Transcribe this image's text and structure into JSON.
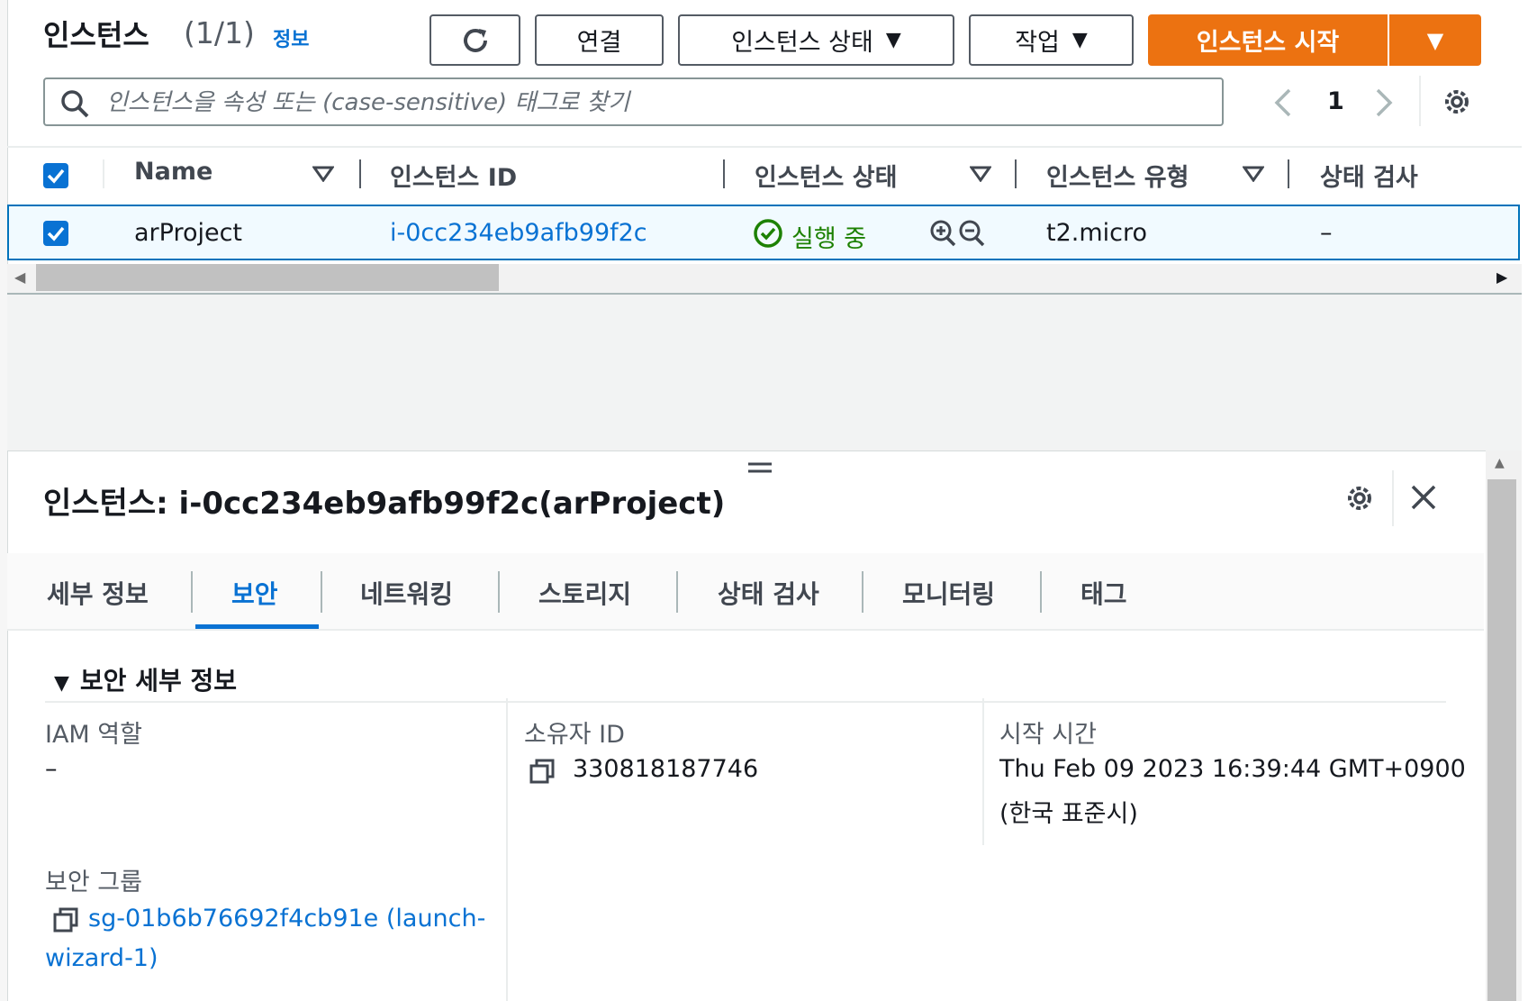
{
  "header": {
    "title": "인스턴스",
    "count": "(1/1)",
    "info_link": "정보",
    "connect_label": "연결",
    "instance_state_label": "인스턴스 상태",
    "actions_label": "작업",
    "launch_label": "인스턴스 시작"
  },
  "search": {
    "placeholder": "인스턴스을 속성 또는 (case-sensitive) 태그로 찾기"
  },
  "pagination": {
    "current_page": "1"
  },
  "table": {
    "columns": [
      "Name",
      "인스턴스 ID",
      "인스턴스 상태",
      "인스턴스 유형",
      "상태 검사"
    ],
    "rows": [
      {
        "name": "arProject",
        "instance_id": "i-0cc234eb9afb99f2c",
        "state": "실행 중",
        "type": "t2.micro",
        "status_check": "–",
        "selected": true
      }
    ]
  },
  "detail": {
    "title": "인스턴스: i-0cc234eb9afb99f2c(arProject)",
    "tabs": [
      "세부 정보",
      "보안",
      "네트워킹",
      "스토리지",
      "상태 검사",
      "모니터링",
      "태그"
    ],
    "active_tab": "보안",
    "section_title": "보안 세부 정보",
    "iam_role_label": "IAM 역할",
    "iam_role_value": "–",
    "owner_id_label": "소유자 ID",
    "owner_id_value": "330818187746",
    "launch_time_label": "시작 시간",
    "launch_time_value_line1": "Thu Feb 09 2023 16:39:44 GMT+0900",
    "launch_time_value_line2": "(한국 표준시)",
    "security_groups_label": "보안 그룹",
    "security_group_line1": "sg-01b6b76692f4cb91e (launch-",
    "security_group_line2": "wizard-1)"
  },
  "colors": {
    "primary": "#ec7211",
    "link": "#0972d3",
    "success": "#1d8102",
    "selected_row": "#f1faff"
  }
}
